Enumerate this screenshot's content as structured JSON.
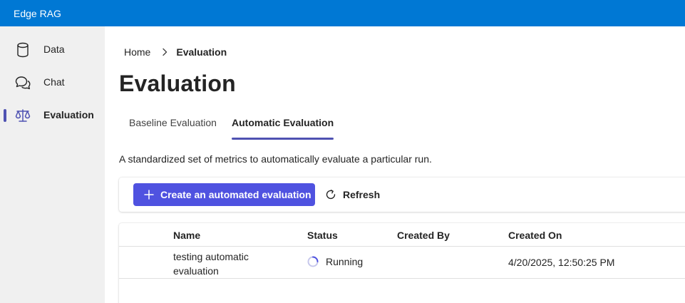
{
  "app": {
    "title": "Edge RAG"
  },
  "sidebar": {
    "items": [
      {
        "label": "Data",
        "icon": "database-icon"
      },
      {
        "label": "Chat",
        "icon": "chat-icon"
      },
      {
        "label": "Evaluation",
        "icon": "scale-icon",
        "active": true
      }
    ]
  },
  "breadcrumb": {
    "home": "Home",
    "current": "Evaluation"
  },
  "page": {
    "title": "Evaluation"
  },
  "tabs": [
    {
      "label": "Baseline Evaluation",
      "active": false
    },
    {
      "label": "Automatic Evaluation",
      "active": true
    }
  ],
  "description": "A standardized set of metrics to automatically evaluate a particular run.",
  "toolbar": {
    "create_label": "Create an automated evaluation",
    "refresh_label": "Refresh"
  },
  "table": {
    "columns": [
      "Name",
      "Status",
      "Created By",
      "Created On"
    ],
    "rows": [
      {
        "name": "testing automatic evaluation",
        "status": "Running",
        "created_by": "",
        "created_on": "4/20/2025, 12:50:25 PM"
      }
    ]
  },
  "colors": {
    "topbar": "#0078d4",
    "accent": "#4f52b2",
    "primary_button": "#4f52e0",
    "sidebar_bg": "#f0f0f0"
  }
}
